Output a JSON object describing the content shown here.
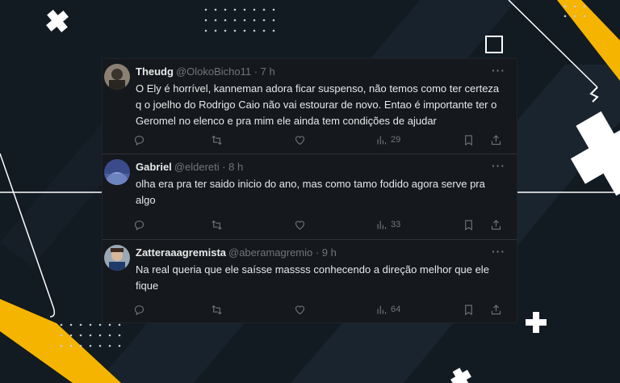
{
  "colors": {
    "background": "#121a22",
    "card": "#15181c",
    "text": "#e7e9ea",
    "muted": "#71767b",
    "accent": "#f5b400"
  },
  "tweets": [
    {
      "name": "Theudg",
      "handle": "@OlokoBicho11 · 7 h",
      "text": "O Ely é horrível, kanneman adora ficar suspenso, não temos como ter certeza q o joelho do Rodrigo Caio não vai estourar de novo. Entao é importante ter o Geromel no elenco e pra mim ele ainda tem condições de ajudar",
      "views": "29",
      "more": "···"
    },
    {
      "name": "Gabriel",
      "handle": "@eldereti · 8 h",
      "text": "olha era pra ter saido inicio do ano, mas como tamo fodido agora serve pra algo",
      "views": "33",
      "more": "···"
    },
    {
      "name": "Zatteraaagremista",
      "handle": "@aberamagremio · 9 h",
      "text": "Na real queria que ele saísse massss conhecendo a direção melhor que ele fique",
      "views": "64",
      "more": "···"
    }
  ],
  "icons": [
    "reply-icon",
    "retweet-icon",
    "like-icon",
    "views-icon",
    "bookmark-icon",
    "share-icon"
  ]
}
